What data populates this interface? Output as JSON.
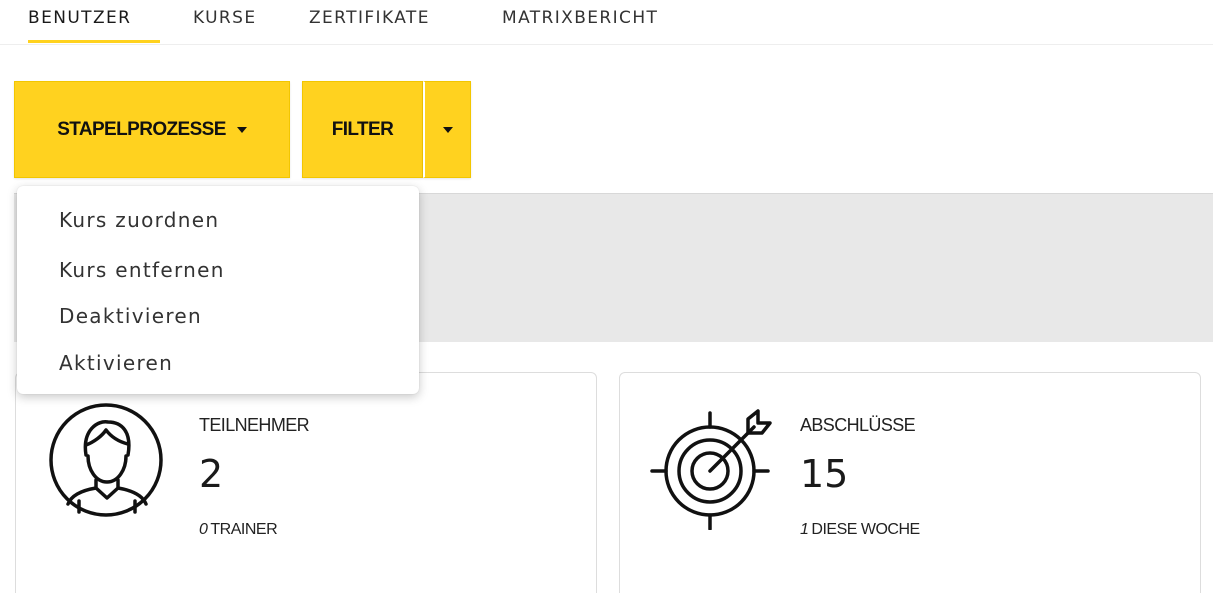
{
  "nav": {
    "tabs": [
      {
        "label": "BENUTZER",
        "active": true
      },
      {
        "label": "KURSE",
        "active": false
      },
      {
        "label": "ZERTIFIKATE",
        "active": false
      },
      {
        "label": "MATRIXBERICHT",
        "active": false
      }
    ]
  },
  "toolbar": {
    "batch_label": "STAPELPROZESSE",
    "filter_label": "FILTER",
    "accent_color": "#ffd21f"
  },
  "batch_menu": {
    "items": [
      "Kurs zuordnen",
      "Kurs entfernen",
      "Deaktivieren",
      "Aktivieren"
    ]
  },
  "cards": {
    "participants": {
      "icon": "user-icon",
      "title": "TEILNEHMER",
      "value": "2",
      "sub_number": "0",
      "sub_label": "TRAINER"
    },
    "completions": {
      "icon": "target-icon",
      "title": "ABSCHLÜSSE",
      "value": "15",
      "sub_number": "1",
      "sub_label": "DIESE WOCHE"
    }
  }
}
